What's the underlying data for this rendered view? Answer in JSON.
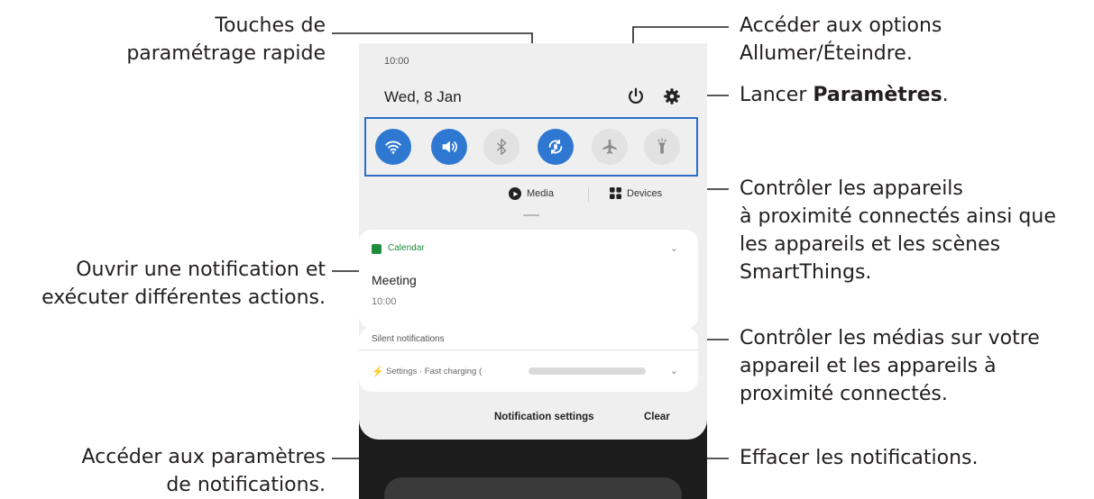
{
  "callouts": {
    "quick_settings": [
      "Touches de",
      "paramétrage rapide"
    ],
    "power": [
      "Accéder aux options",
      "Allumer/Éteindre."
    ],
    "settings_prefix": "Lancer ",
    "settings_bold": "Paramètres",
    "settings_suffix": ".",
    "devices": [
      "Contrôler les appareils",
      "à proximité connectés ainsi que",
      "les appareils et les scènes",
      "SmartThings."
    ],
    "notification": [
      "Ouvrir une notification et",
      "exécuter différentes actions."
    ],
    "media": [
      "Contrôler les médias sur votre",
      "appareil et les appareils à",
      "proximité connectés."
    ],
    "notif_settings": [
      "Accéder aux paramètres",
      "de notifications."
    ],
    "clear": "Effacer les notifications."
  },
  "phone": {
    "time": "10:00",
    "date": "Wed, 8 Jan",
    "quick_toggles": [
      {
        "icon": "wifi-icon",
        "state": "on"
      },
      {
        "icon": "sound-icon",
        "state": "on"
      },
      {
        "icon": "bluetooth-icon",
        "state": "off"
      },
      {
        "icon": "auto-rotate-icon",
        "state": "on"
      },
      {
        "icon": "airplane-icon",
        "state": "off"
      },
      {
        "icon": "flashlight-icon",
        "state": "off"
      }
    ],
    "media_label": "Media",
    "devices_label": "Devices",
    "notification": {
      "app": "Calendar",
      "title": "Meeting",
      "time": "10:00"
    },
    "silent_header": "Silent notifications",
    "silent_item": "Settings · Fast charging (",
    "notification_settings": "Notification settings",
    "clear": "Clear"
  },
  "colors": {
    "accent": "#2f78d2",
    "highlight_border": "#2d6fc6",
    "calendar_green": "#1e8e3e"
  }
}
